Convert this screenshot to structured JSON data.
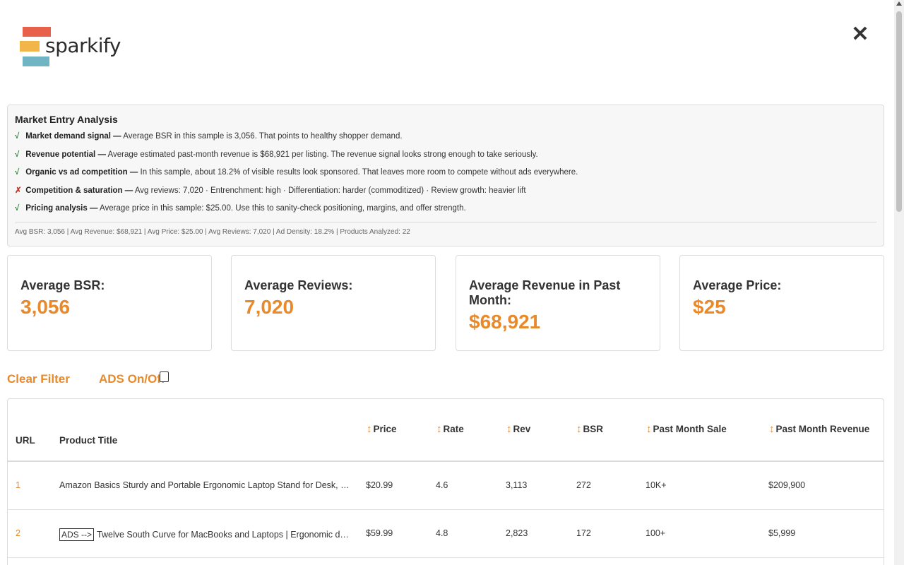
{
  "brand": {
    "name": "sparkify"
  },
  "analysis": {
    "title": "Market Entry Analysis",
    "points": [
      {
        "status": "ok",
        "mark": "√",
        "label": "Market demand signal —",
        "text": " Average BSR in this sample is 3,056. That points to healthy shopper demand."
      },
      {
        "status": "ok",
        "mark": "√",
        "label": "Revenue potential —",
        "text": " Average estimated past-month revenue is $68,921 per listing. The revenue signal looks strong enough to take seriously."
      },
      {
        "status": "ok",
        "mark": "√",
        "label": "Organic vs ad competition —",
        "text": " In this sample, about 18.2% of visible results look sponsored. That leaves more room to compete without ads everywhere."
      },
      {
        "status": "bad",
        "mark": "✗",
        "label": "Competition & saturation —",
        "text": " Avg reviews: 7,020 · Entrenchment: high · Differentiation: harder (commoditized) · Review growth: heavier lift"
      },
      {
        "status": "ok",
        "mark": "√",
        "label": "Pricing analysis —",
        "text": " Average price in this sample: $25.00. Use this to sanity-check positioning, margins, and offer strength."
      }
    ],
    "summary": "Avg BSR: 3,056 | Avg Revenue: $68,921 | Avg Price: $25.00 | Avg Reviews: 7,020 | Ad Density: 18.2% | Products Analyzed: 22"
  },
  "cards": [
    {
      "label": "Average BSR:",
      "value": "3,056"
    },
    {
      "label": "Average Reviews:",
      "value": "7,020"
    },
    {
      "label": "Average Revenue in Past Month:",
      "value": "$68,921"
    },
    {
      "label": "Average Price:",
      "value": "$25"
    }
  ],
  "filters": {
    "clear_label": "Clear Filter",
    "ads_label": "ADS On/Off",
    "ads_checked": false
  },
  "table": {
    "headers": {
      "url": "URL",
      "title": "Product Title",
      "price": "Price",
      "rate": "Rate",
      "rev": "Rev",
      "bsr": "BSR",
      "pms": "Past Month Sale",
      "pmr": "Past Month Revenue"
    },
    "rows": [
      {
        "idx": "1",
        "ads": "",
        "title": "Amazon Basics Sturdy and Portable Ergonomic Laptop Stand for Desk, Height Adjustable",
        "price": "$20.99",
        "rate": "4.6",
        "rev": "3,113",
        "bsr": "272",
        "pms": "10K+",
        "pmr": "$209,900"
      },
      {
        "idx": "2",
        "ads": "ADS -->",
        "title": "Twelve South Curve for MacBooks and Laptops | Ergonomic desktop cooling stand",
        "price": "$59.99",
        "rate": "4.8",
        "rev": "2,823",
        "bsr": "172",
        "pms": "100+",
        "pmr": "$5,999"
      }
    ]
  },
  "colors": {
    "accent": "#e8892a",
    "ok": "#2e8b3a",
    "bad": "#c0392b"
  }
}
